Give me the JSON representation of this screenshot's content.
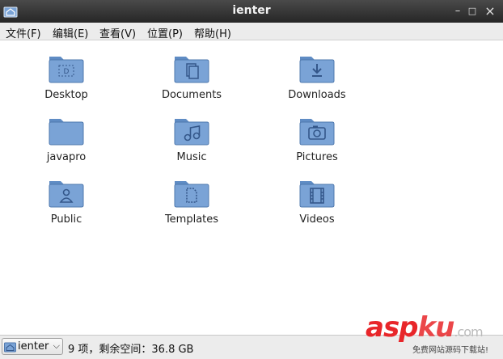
{
  "window": {
    "title": "ienter",
    "controls": {
      "minimize": "–",
      "maximize": "□",
      "close": "×"
    }
  },
  "menu": [
    {
      "label": "文件(F)",
      "icon": ""
    },
    {
      "label": "编辑(E)"
    },
    {
      "label": "查看(V)"
    },
    {
      "label": "位置(P)"
    },
    {
      "label": "帮助(H)"
    }
  ],
  "items": [
    {
      "label": "Desktop",
      "icon": "desktop-folder-icon"
    },
    {
      "label": "Documents",
      "icon": "documents-folder-icon"
    },
    {
      "label": "Downloads",
      "icon": "downloads-folder-icon"
    },
    {
      "label": "javapro",
      "icon": "folder-icon"
    },
    {
      "label": "Music",
      "icon": "music-folder-icon"
    },
    {
      "label": "Pictures",
      "icon": "pictures-folder-icon"
    },
    {
      "label": "Public",
      "icon": "public-folder-icon"
    },
    {
      "label": "Templates",
      "icon": "templates-folder-icon"
    },
    {
      "label": "Videos",
      "icon": "videos-folder-icon"
    }
  ],
  "status": {
    "location": "ienter",
    "text": "9 项，剩余空间：36.8 GB"
  },
  "watermark": {
    "asp": "asp",
    "ku": "ku",
    "com": ".com",
    "subtitle": "免费网站源码下载站!"
  },
  "colors": {
    "folder_body": "#7aa3d6",
    "folder_tab": "#5f8cc4",
    "folder_emblem": "#34578a"
  }
}
